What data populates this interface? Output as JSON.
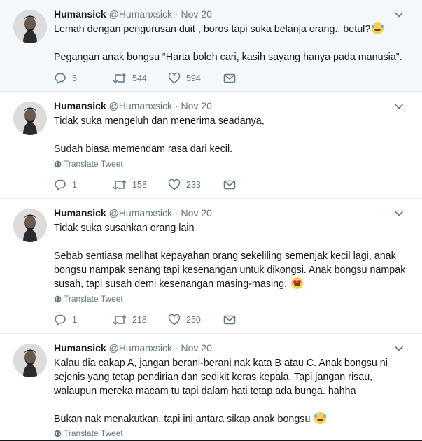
{
  "tweets": [
    {
      "name": "Humansick",
      "handle": "@Humanxsick",
      "time": "Nov 20",
      "paragraphs": [
        "Lemah dengan pengurusan duit , boros tapi suka belanja orang.. betul?",
        "Pegangan anak bongsu “Harta boleh cari, kasih sayang hanya pada manusia”."
      ],
      "replies": "5",
      "retweets": "544",
      "likes": "594"
    },
    {
      "name": "Humansick",
      "handle": "@Humanxsick",
      "time": "Nov 20",
      "paragraphs": [
        "Tidak suka mengeluh dan menerima seadanya,",
        "Sudah biasa memendam rasa dari kecil."
      ],
      "translate": "Translate Tweet",
      "replies": "1",
      "retweets": "158",
      "likes": "233"
    },
    {
      "name": "Humansick",
      "handle": "@Humanxsick",
      "time": "Nov 20",
      "paragraphs": [
        "Tidak suka susahkan orang lain",
        "Sebab sentiasa melihat kepayahan orang sekeliling semenjak kecil lagi, anak bongsu nampak senang tapi kesenangan untuk dikongsi. Anak bongsu nampak susah, tapi susah demi kesenangan masing-masing."
      ],
      "translate": "Translate Tweet",
      "replies": "1",
      "retweets": "218",
      "likes": "250"
    },
    {
      "name": "Humansick",
      "handle": "@Humanxsick",
      "time": "Nov 20",
      "paragraphs": [
        "Kalau dia cakap A, jangan berani-berani nak kata B atau C. Anak bongsu ni sejenis yang tetap pendirian dan sedikit keras kepala. Tapi jangan risau, walaupun mereka macam tu tapi dalam hati tetap ada bunga. hahha",
        "Bukan nak menakutkan, tapi ini antara sikap anak bongsu"
      ],
      "translate": "Translate Tweet"
    }
  ],
  "separator": "·",
  "colors": {
    "text": "#14171a",
    "secondary": "#657786",
    "highlight_bg": "#f5f8fa",
    "divider": "#e6ecf0"
  },
  "icons": [
    "chevron-down-icon",
    "reply-icon",
    "retweet-icon",
    "like-icon",
    "message-icon",
    "globe-icon",
    "laughing-emoji-icon",
    "heart-eyes-emoji-icon"
  ]
}
